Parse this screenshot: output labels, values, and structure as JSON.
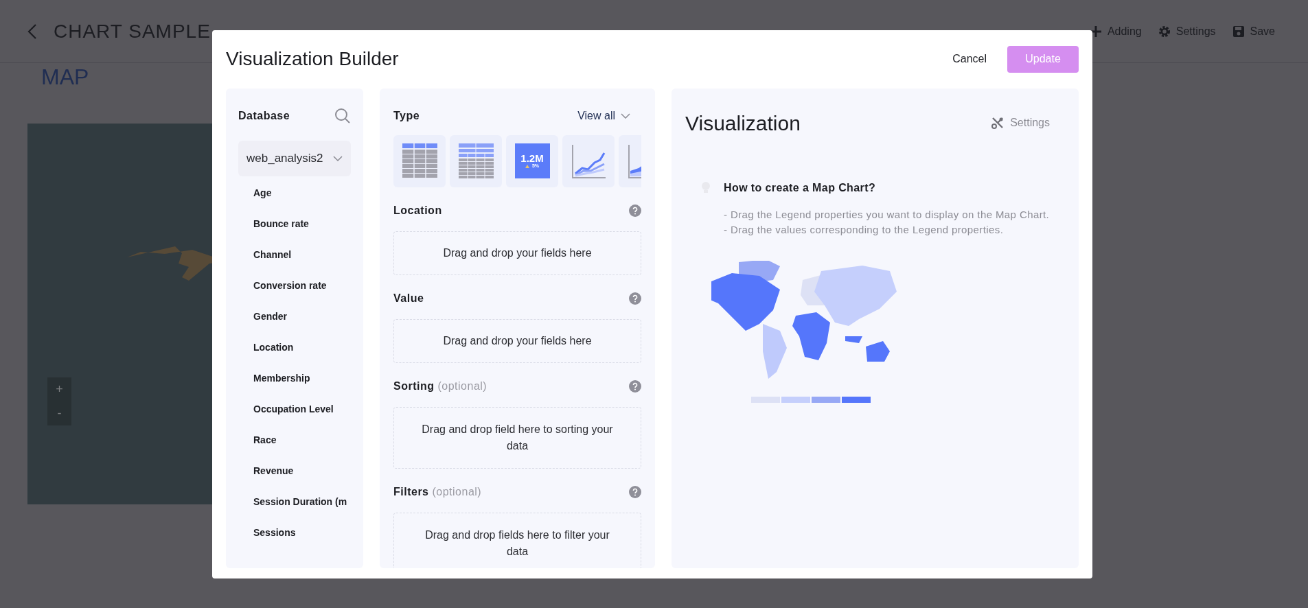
{
  "page": {
    "title": "CHART SAMPLE",
    "section": "MAP",
    "toolbar": [
      {
        "label": "Adding",
        "kind": "plus"
      },
      {
        "label": "Settings",
        "kind": "gear"
      },
      {
        "label": "Save",
        "kind": "save"
      }
    ],
    "map": {
      "zoom_in": "+",
      "zoom_out": "-"
    }
  },
  "modal": {
    "title": "Visualization Builder",
    "cancel": "Cancel",
    "update": {
      "label": "Update",
      "disabled": true
    }
  },
  "database": {
    "label": "Database",
    "selected_db": "web_analysis2",
    "fields": [
      "Age",
      "Bounce rate",
      "Channel",
      "Conversion rate",
      "Gender",
      "Location",
      "Membership",
      "Occupation Level",
      "Race",
      "Revenue",
      "Session Duration (m",
      "Sessions"
    ]
  },
  "type_section": {
    "label": "Type",
    "view_all": "View all",
    "types": [
      {
        "kind": "table"
      },
      {
        "kind": "pivot"
      },
      {
        "kind": "kpi",
        "value": "1.2M",
        "delta": "5%"
      },
      {
        "kind": "line"
      },
      {
        "kind": "area"
      }
    ]
  },
  "drop_zones": [
    {
      "label": "Location",
      "hint": "Drag and drop your fields here"
    },
    {
      "label": "Value",
      "hint": "Drag and drop your fields here"
    },
    {
      "label": "Sorting",
      "note": "(optional)",
      "hint": "Drag and drop field here to sorting your data"
    },
    {
      "label": "Filters",
      "note": "(optional)",
      "hint": "Drag and drop fields here to filter your data"
    }
  ],
  "visualization": {
    "title": "Visualization",
    "settings": "Settings",
    "tip_title": "How to create a Map Chart?",
    "tip_lines": [
      "- Drag the Legend properties you want to display on the Map Chart.",
      "- Drag the values corresponding to the Legend properties."
    ]
  }
}
